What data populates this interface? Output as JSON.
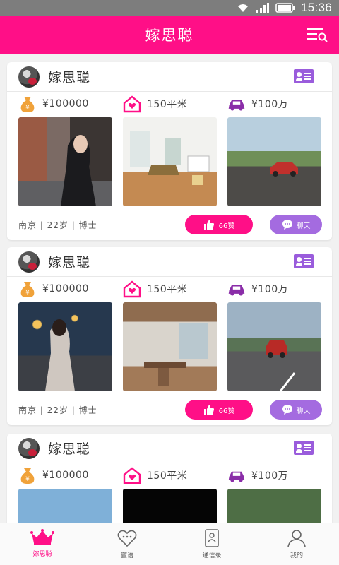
{
  "status_bar": {
    "time": "15:36"
  },
  "header": {
    "title": "嫁思聪"
  },
  "cards": [
    {
      "name": "嫁思聪",
      "money": "¥100000",
      "house": "150平米",
      "car": "¥100万",
      "info": "南京 | 22岁 | 博士",
      "likes": "66赞",
      "chat": "聊天"
    },
    {
      "name": "嫁思聪",
      "money": "¥100000",
      "house": "150平米",
      "car": "¥100万",
      "info": "南京 | 22岁 | 博士",
      "likes": "66赞",
      "chat": "聊天"
    },
    {
      "name": "嫁思聪",
      "money": "¥100000",
      "house": "150平米",
      "car": "¥100万"
    }
  ],
  "tabs": [
    {
      "label": "嫁思聪",
      "icon": "crown-icon",
      "active": true
    },
    {
      "label": "蜜语",
      "icon": "heart-chat-icon"
    },
    {
      "label": "通信录",
      "icon": "contacts-book-icon"
    },
    {
      "label": "我的",
      "icon": "person-icon"
    }
  ],
  "colors": {
    "primary": "#ff0f87",
    "purple": "#9a5cdc",
    "gold": "#f0a23a",
    "chat": "#a46be0"
  }
}
